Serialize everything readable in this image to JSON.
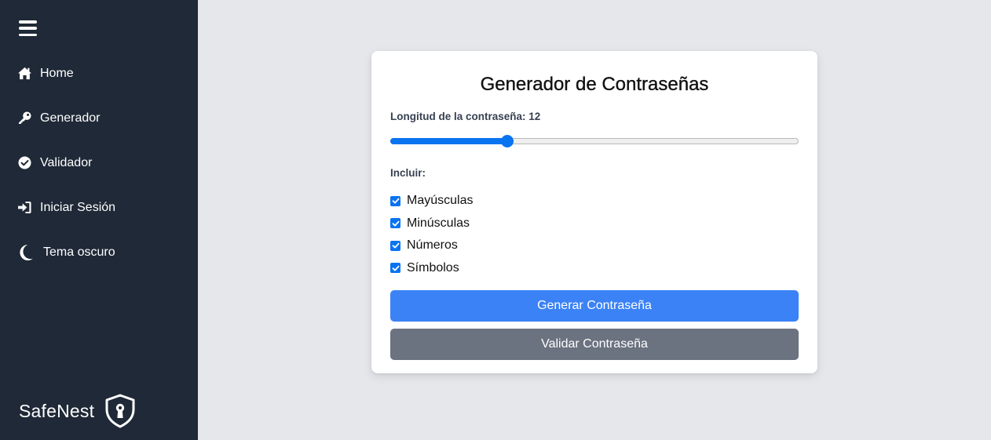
{
  "sidebar": {
    "menu_icon": "hamburger-menu-icon",
    "items": [
      {
        "label": "Home",
        "icon": "home-icon"
      },
      {
        "label": "Generador",
        "icon": "key-icon"
      },
      {
        "label": "Validador",
        "icon": "check-circle-icon"
      },
      {
        "label": "Iniciar Sesión",
        "icon": "sign-in-icon"
      },
      {
        "label": "Tema oscuro",
        "icon": "moon-icon"
      }
    ],
    "brand": {
      "name": "SafeNest",
      "icon": "shield-keyhole-icon"
    }
  },
  "card": {
    "title": "Generador de Contraseñas",
    "length_label": "Longitud de la contraseña: 12",
    "slider": {
      "value": 12,
      "min": 4,
      "max": 32,
      "accent": "#0a74f0"
    },
    "include_label": "Incluir:",
    "options": [
      {
        "label": "Mayúsculas",
        "checked": true
      },
      {
        "label": "Minúsculas",
        "checked": true
      },
      {
        "label": "Números",
        "checked": true
      },
      {
        "label": "Símbolos",
        "checked": true
      }
    ],
    "generate_button": "Generar Contraseña",
    "validate_button": "Validar Contraseña"
  },
  "colors": {
    "sidebar_bg": "#1f2937",
    "page_bg": "#e5e7eb",
    "primary": "#3b82f6",
    "secondary": "#6b7280"
  }
}
